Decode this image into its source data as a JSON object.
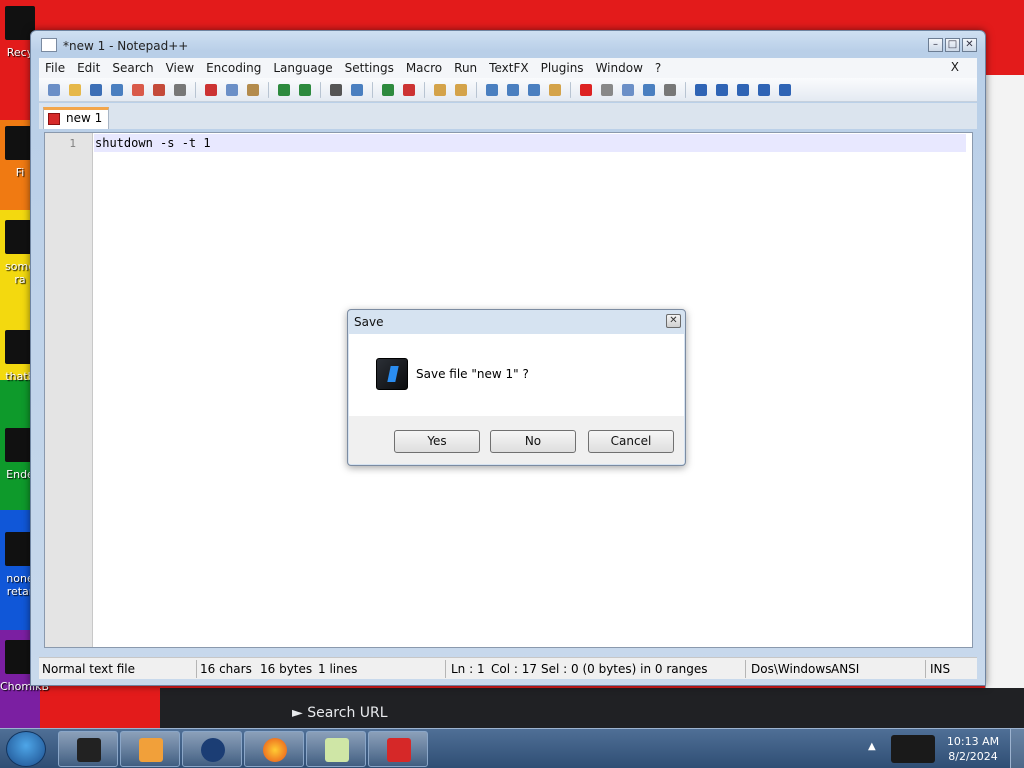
{
  "desktop": {
    "icons": [
      {
        "label": "Recy"
      },
      {
        "label": "Fi"
      },
      {
        "label": "some ra"
      },
      {
        "label": "thatb"
      },
      {
        "label": "Ende"
      },
      {
        "label": "none retar"
      },
      {
        "label": "ChomikB"
      }
    ]
  },
  "browser_remnant": {
    "search_url": "► Search URL"
  },
  "window": {
    "title": "*new 1 - Notepad++",
    "buttons": {
      "minimize": "–",
      "maximize": "□",
      "close": "✕"
    }
  },
  "menu": {
    "items": [
      "File",
      "Edit",
      "Search",
      "View",
      "Encoding",
      "Language",
      "Settings",
      "Macro",
      "Run",
      "TextFX",
      "Plugins",
      "Window",
      "?"
    ],
    "close": "X"
  },
  "toolbar": {
    "icons": [
      "new-file-icon",
      "open-icon",
      "save-icon",
      "save-all-icon",
      "close-icon",
      "close-all-icon",
      "print-icon",
      "cut-icon",
      "copy-icon",
      "paste-icon",
      "undo-icon",
      "redo-icon",
      "find-icon",
      "replace-icon",
      "zoom-in-icon",
      "zoom-out-icon",
      "sync-v-icon",
      "sync-h-icon",
      "wrap-icon",
      "all-chars-icon",
      "indent-guide-icon",
      "fold-icon",
      "record-macro-icon",
      "stop-macro-icon",
      "play-macro-icon",
      "run-macro-multiple-icon",
      "save-macro-icon",
      "collapse-icon",
      "up-icon",
      "down-icon",
      "expand-icon",
      "spellcheck-icon"
    ]
  },
  "tabs": [
    {
      "label": "new 1",
      "active": true
    }
  ],
  "editor": {
    "line_numbers": [
      "1"
    ],
    "lines": [
      "shutdown -s -t 1"
    ]
  },
  "status": {
    "file_type": "Normal text file",
    "chars": "16 chars",
    "bytes": "16 bytes",
    "lines": "1 lines",
    "ln": "Ln : 1",
    "col": "Col : 17",
    "sel": "Sel : 0 (0 bytes) in 0 ranges",
    "eol": "Dos\\Windows",
    "encoding": "ANSI",
    "mode": "INS"
  },
  "dialog": {
    "title": "Save",
    "message": "Save file \"new 1\" ?",
    "buttons": {
      "yes": "Yes",
      "no": "No",
      "cancel": "Cancel"
    }
  },
  "taskbar": {
    "time": "10:13 AM",
    "date": "8/2/2024"
  }
}
